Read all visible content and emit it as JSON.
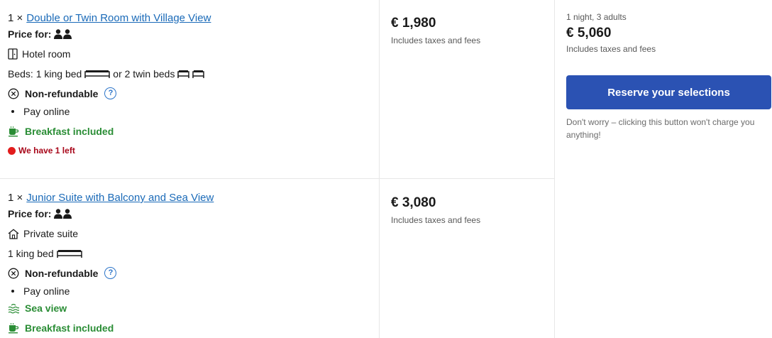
{
  "rooms": [
    {
      "qty": "1 ×",
      "name": "Double or Twin Room with Village View",
      "price_for_label": "Price for:",
      "room_type": "Hotel room",
      "beds_prefix": "Beds: 1 king bed",
      "beds_or": "or 2 twin beds",
      "refund": "Non-refundable",
      "help": "?",
      "payment": "Pay online",
      "meal": "Breakfast included",
      "scarcity": "We have 1 left",
      "price": "€ 1,980",
      "price_note": "Includes taxes and fees"
    },
    {
      "qty": "1 ×",
      "name": "Junior Suite with Balcony and Sea View",
      "price_for_label": "Price for:",
      "room_type": "Private suite",
      "beds_prefix": "1 king bed",
      "refund": "Non-refundable",
      "help": "?",
      "payment": "Pay online",
      "view": "Sea view",
      "meal": "Breakfast included",
      "price": "€ 3,080",
      "price_note": "Includes taxes and fees"
    }
  ],
  "summary": {
    "meta": "1 night, 3 adults",
    "total": "€ 5,060",
    "total_note": "Includes taxes and fees",
    "reserve_label": "Reserve your selections",
    "note": "Don't worry – clicking this button won't charge you anything!"
  },
  "colors": {
    "link": "#1a6ab8",
    "primary_button": "#2b52b3",
    "positive": "#2a8d35",
    "scarcity": "#a8071a",
    "divider": "#e7e7e7"
  },
  "icons": [
    "guests-icon",
    "door-icon",
    "king-bed-icon",
    "twin-bed-icon",
    "cancel-circle-icon",
    "help-icon",
    "coffee-cup-icon",
    "red-dot-icon",
    "house-icon",
    "sea-view-icon"
  ]
}
